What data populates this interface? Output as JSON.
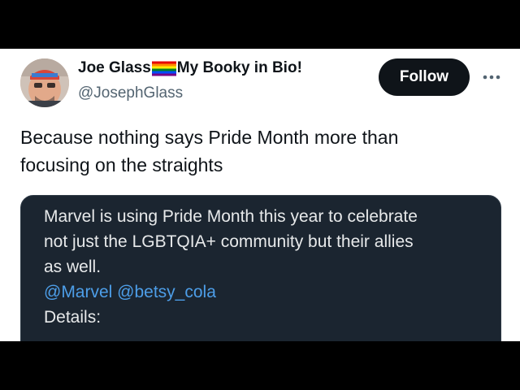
{
  "tweet": {
    "author": {
      "name": "Joe Glass",
      "name_suffix": "My Booky in Bio!",
      "flag_icon": "rainbow-pride-flag-icon",
      "handle": "@JosephGlass"
    },
    "follow_label": "Follow",
    "more_icon": "more-horizontal-icon",
    "text_line1": "Because nothing says Pride Month more than",
    "text_line2": "focusing on the straights"
  },
  "quote": {
    "line1": "Marvel is using Pride Month this year to celebrate",
    "line2": "not just the LGBTQIA+ community but their allies",
    "line3": "as well.",
    "mention1": "@Marvel",
    "mention2": "@betsy_cola",
    "details": "Details:"
  },
  "colors": {
    "text_primary": "#0f1419",
    "text_secondary": "#536471",
    "follow_bg": "#0f1419",
    "quote_bg": "#1b2530",
    "mention": "#4d9ee8"
  }
}
